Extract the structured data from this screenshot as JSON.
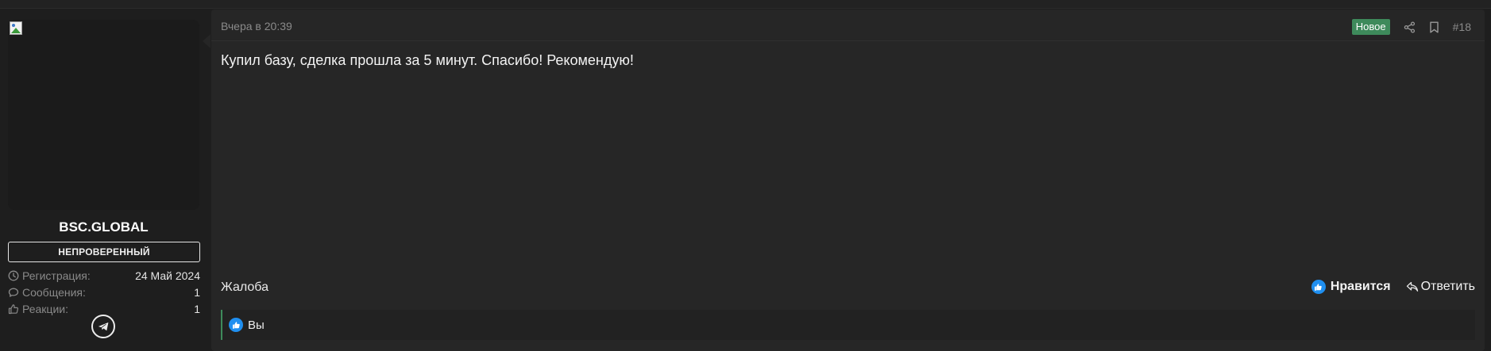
{
  "user": {
    "name": "BSC.GLOBAL",
    "badge": "НЕПРОВЕРЕННЫЙ",
    "stats": [
      {
        "icon": "clock-icon",
        "label": "Регистрация:",
        "value": "24 Май 2024"
      },
      {
        "icon": "comments-icon",
        "label": "Сообщения:",
        "value": "1"
      },
      {
        "icon": "thumbs-up-icon",
        "label": "Реакции:",
        "value": "1"
      }
    ],
    "contact_icon": "telegram-icon"
  },
  "post": {
    "date": "Вчера в 20:39",
    "new_label": "Новое",
    "number": "#18",
    "text": "Купил базу, сделка прошла за 5 минут. Спасибо! Рекомендую!",
    "report_label": "Жалоба",
    "like_label": "Нравится",
    "reply_label": "Ответить",
    "reactions_user": "Вы"
  },
  "colors": {
    "new_badge": "#3e8a5b",
    "like_blue": "#1f8ff0",
    "background": "#1e1e1e",
    "message_bg": "#262626"
  }
}
